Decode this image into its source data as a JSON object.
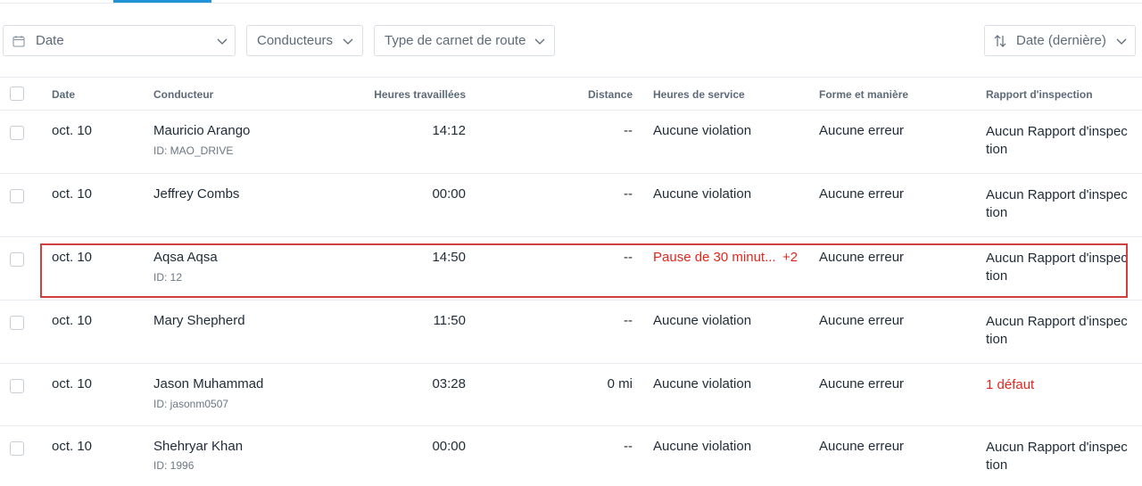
{
  "filters": {
    "date_label": "Date",
    "drivers_label": "Conducteurs",
    "log_type_label": "Type de carnet de route",
    "sort_label": "Date (dernière)"
  },
  "table": {
    "headers": {
      "date": "Date",
      "driver": "Conducteur",
      "hours_worked": "Heures travaillées",
      "distance": "Distance",
      "hos": "Heures de service",
      "form": "Forme et manière",
      "inspection": "Rapport d'inspection"
    },
    "rows": [
      {
        "date": "oct. 10",
        "name": "Mauricio Arango",
        "id": "ID: MAO_DRIVE",
        "hours": "14:12",
        "distance": "--",
        "hos": "Aucune violation",
        "hos_extra": "",
        "form": "Aucune erreur",
        "inspection": "Aucun Rapport d'inspection"
      },
      {
        "date": "oct. 10",
        "name": "Jeffrey Combs",
        "id": "",
        "hours": "00:00",
        "distance": "--",
        "hos": "Aucune violation",
        "hos_extra": "",
        "form": "Aucune erreur",
        "inspection": "Aucun Rapport d'inspection"
      },
      {
        "date": "oct. 10",
        "name": "Aqsa Aqsa",
        "id": "ID: 12",
        "hours": "14:50",
        "distance": "--",
        "hos": "Pause de 30 minut...",
        "hos_extra": "+2",
        "form": "Aucune erreur",
        "inspection": "Aucun Rapport d'inspection"
      },
      {
        "date": "oct. 10",
        "name": "Mary Shepherd",
        "id": "",
        "hours": "11:50",
        "distance": "--",
        "hos": "Aucune violation",
        "hos_extra": "",
        "form": "Aucune erreur",
        "inspection": "Aucun Rapport d'inspection"
      },
      {
        "date": "oct. 10",
        "name": "Jason Muhammad",
        "id": "ID: jasonm0507",
        "hours": "03:28",
        "distance": "0 mi",
        "hos": "Aucune violation",
        "hos_extra": "",
        "form": "Aucune erreur",
        "inspection": "1 défaut"
      },
      {
        "date": "oct. 10",
        "name": "Shehryar Khan",
        "id": "ID: 1996",
        "hours": "00:00",
        "distance": "--",
        "hos": "Aucune violation",
        "hos_extra": "",
        "form": "Aucune erreur",
        "inspection": "Aucun Rapport d'inspection"
      }
    ]
  },
  "colors": {
    "accent": "#1f93d5",
    "violation": "#e0271e",
    "highlight_box": "#d23f3f"
  },
  "icons": {
    "date_filter": "calendar-icon",
    "dropdown": "chevron-down-icon",
    "sort": "sort-arrows-icon"
  }
}
